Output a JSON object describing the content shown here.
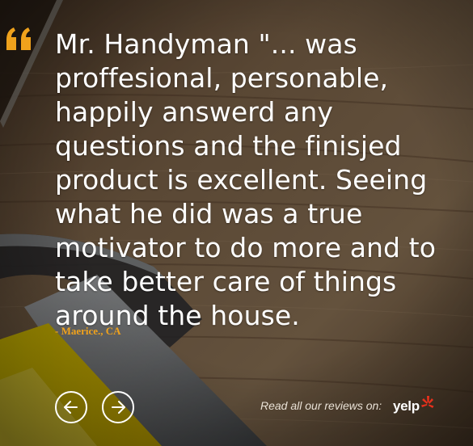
{
  "testimonial": {
    "quote": "Mr. Handyman \"... was proffesional, personable, happily answerd any questions and the finisjed product is excellent. Seeing what he did was a true motivator to do more and to take better care of things around the house.",
    "author": "- Maerice., CA"
  },
  "navigation": {
    "prev_icon": "arrow-left-icon",
    "next_icon": "arrow-right-icon"
  },
  "reviews": {
    "label": "Read all our reviews on:",
    "brand": "yelp"
  },
  "colors": {
    "quote_icon": "#f0a21c",
    "author": "#f0a21c",
    "yelp_burst": "#e8301c",
    "text": "#ffffff"
  }
}
